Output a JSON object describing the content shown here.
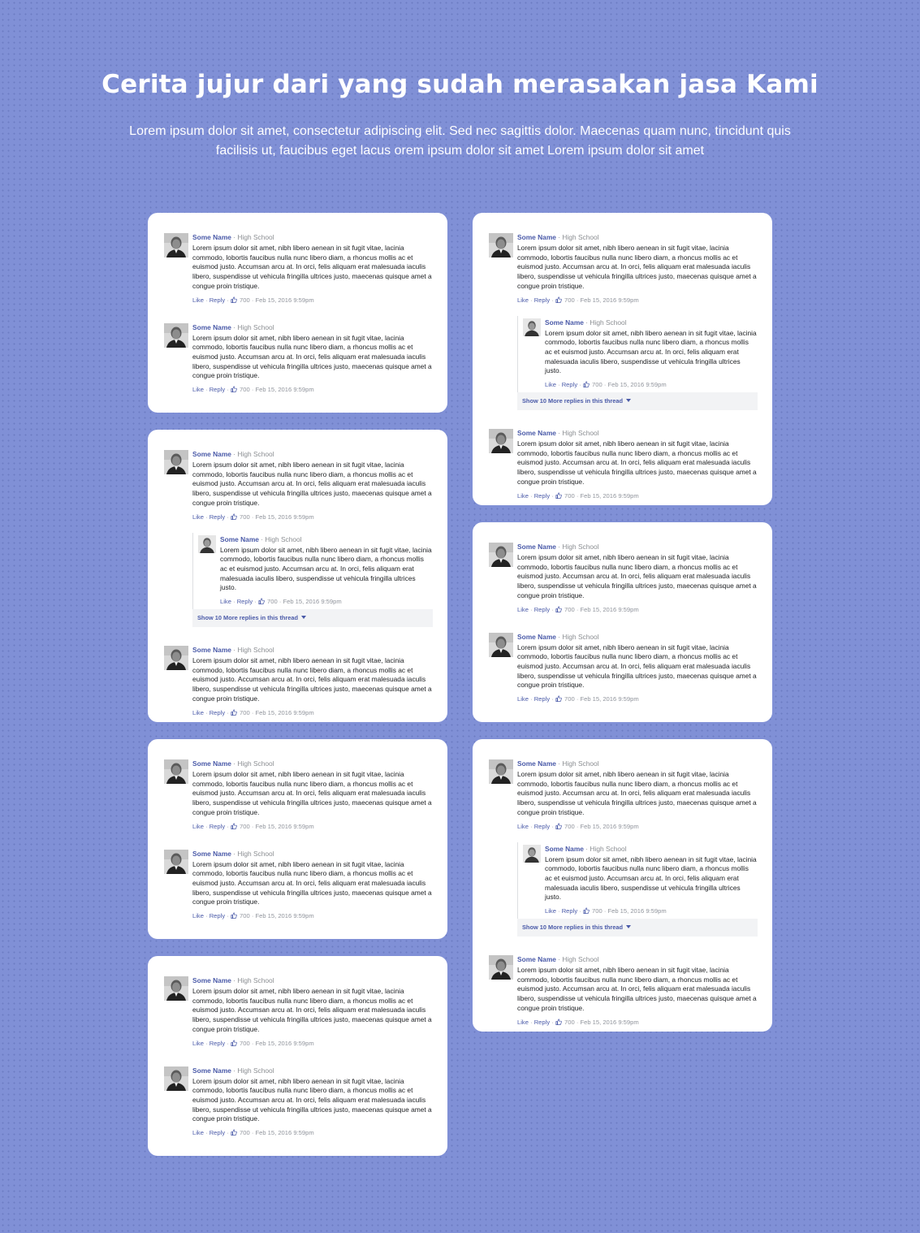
{
  "header": {
    "title": "Cerita jujur dari yang sudah merasakan jasa Kami",
    "subtitle": "Lorem ipsum dolor sit amet, consectetur adipiscing elit. Sed nec sagittis dolor. Maecenas quam nunc, tincidunt quis facilisis ut, faucibus eget lacus orem ipsum dolor sit amet Lorem ipsum dolor sit amet"
  },
  "comment": {
    "name": "Some Name",
    "school": "High School",
    "text": "Lorem ipsum dolor sit amet, nibh libero aenean in sit fugit vitae, lacinia commodo, lobortis faucibus nulla nunc libero diam, a rhoncus mollis ac et euismod justo. Accumsan arcu at. In orci, felis aliquam erat malesuada iaculis libero, suspendisse ut vehicula fringilla ultrices justo, maecenas quisque amet a congue proin tristique.",
    "like_label": "Like",
    "reply_label": "Reply",
    "likes": "700",
    "date": "Feb 15, 2016 9:59pm"
  },
  "reply": {
    "name": "Some Name",
    "school": "High School",
    "text": "Lorem ipsum dolor sit amet, nibh libero aenean in sit fugit vitae, lacinia commodo, lobortis faucibus nulla nunc libero diam, a rhoncus mollis ac et euismod justo. Accumsan arcu at. In orci, felis aliquam erat malesuada iaculis libero, suspendisse ut vehicula fringilla ultrices justo.",
    "like_label": "Like",
    "reply_label": "Reply",
    "likes": "700",
    "date": "Feb 15, 2016 9:59pm"
  },
  "thread": {
    "more_label": "Show 10 More replies in this thread"
  },
  "cards": [
    {
      "id": "left-1",
      "has_thread": false
    },
    {
      "id": "left-2",
      "has_thread": true
    },
    {
      "id": "left-3",
      "has_thread": false
    },
    {
      "id": "left-4",
      "has_thread": false
    },
    {
      "id": "right-1",
      "has_thread": true
    },
    {
      "id": "right-2",
      "has_thread": false
    },
    {
      "id": "right-3",
      "has_thread": true
    }
  ],
  "colors": {
    "background": "#8090d6",
    "accent": "#4a5aa8",
    "card": "#ffffff"
  }
}
